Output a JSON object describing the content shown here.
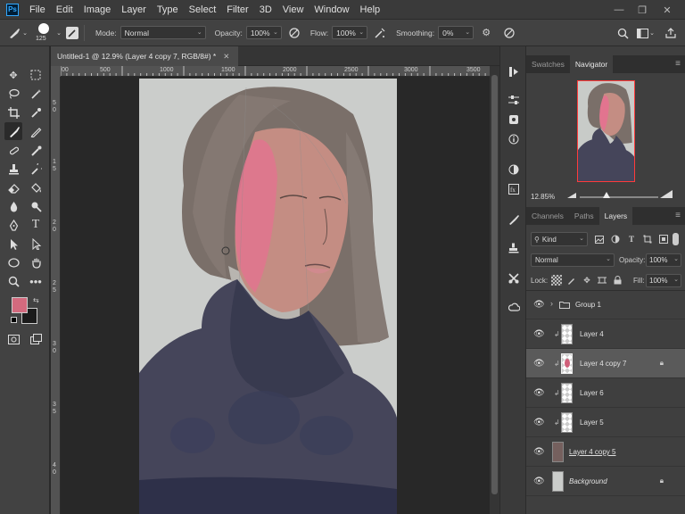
{
  "app": {
    "logo": "Ps"
  },
  "menu": [
    "File",
    "Edit",
    "Image",
    "Layer",
    "Type",
    "Select",
    "Filter",
    "3D",
    "View",
    "Window",
    "Help"
  ],
  "window_controls": {
    "minimize": "—",
    "restore": "❐",
    "close": "✕"
  },
  "options_bar": {
    "brush_size": "125",
    "mode_label": "Mode:",
    "mode_value": "Normal",
    "opacity_label": "Opacity:",
    "opacity_value": "100%",
    "flow_label": "Flow:",
    "flow_value": "100%",
    "smoothing_label": "Smoothing:",
    "smoothing_value": "0%"
  },
  "document": {
    "tab_title": "Untitled-1 @ 12.9% (Layer 4 copy 7, RGB/8#) *",
    "close": "✕"
  },
  "ruler": {
    "h_ticks": [
      "00",
      "500",
      "1000",
      "1500",
      "2000",
      "2500",
      "3000",
      "3500"
    ],
    "v_ticks": [
      "5",
      "0",
      "1",
      "5",
      "2",
      "0",
      "2",
      "5",
      "3",
      "0",
      "3",
      "5",
      "4",
      "0",
      "4",
      "5"
    ]
  },
  "navigator_panel": {
    "tabs": [
      "Swatches",
      "Navigator"
    ],
    "active": "Navigator",
    "zoom": "12.85%"
  },
  "layers_panel": {
    "tabs": [
      "Channels",
      "Paths",
      "Layers"
    ],
    "active": "Layers",
    "filter_kind": "Kind",
    "blend_mode": "Normal",
    "opacity_label": "Opacity:",
    "opacity_value": "100%",
    "lock_label": "Lock:",
    "fill_label": "Fill:",
    "fill_value": "100%",
    "layers": [
      {
        "name": "Group 1"
      },
      {
        "name": "Layer 4"
      },
      {
        "name": "Layer 4 copy 7"
      },
      {
        "name": "Layer 6"
      },
      {
        "name": "Layer 5"
      },
      {
        "name": "Layer 4 copy 5"
      },
      {
        "name": "Background"
      }
    ]
  },
  "colors": {
    "foreground": "#d36a7e",
    "background": "#1b1b1b",
    "accent": "#31a8ff"
  }
}
